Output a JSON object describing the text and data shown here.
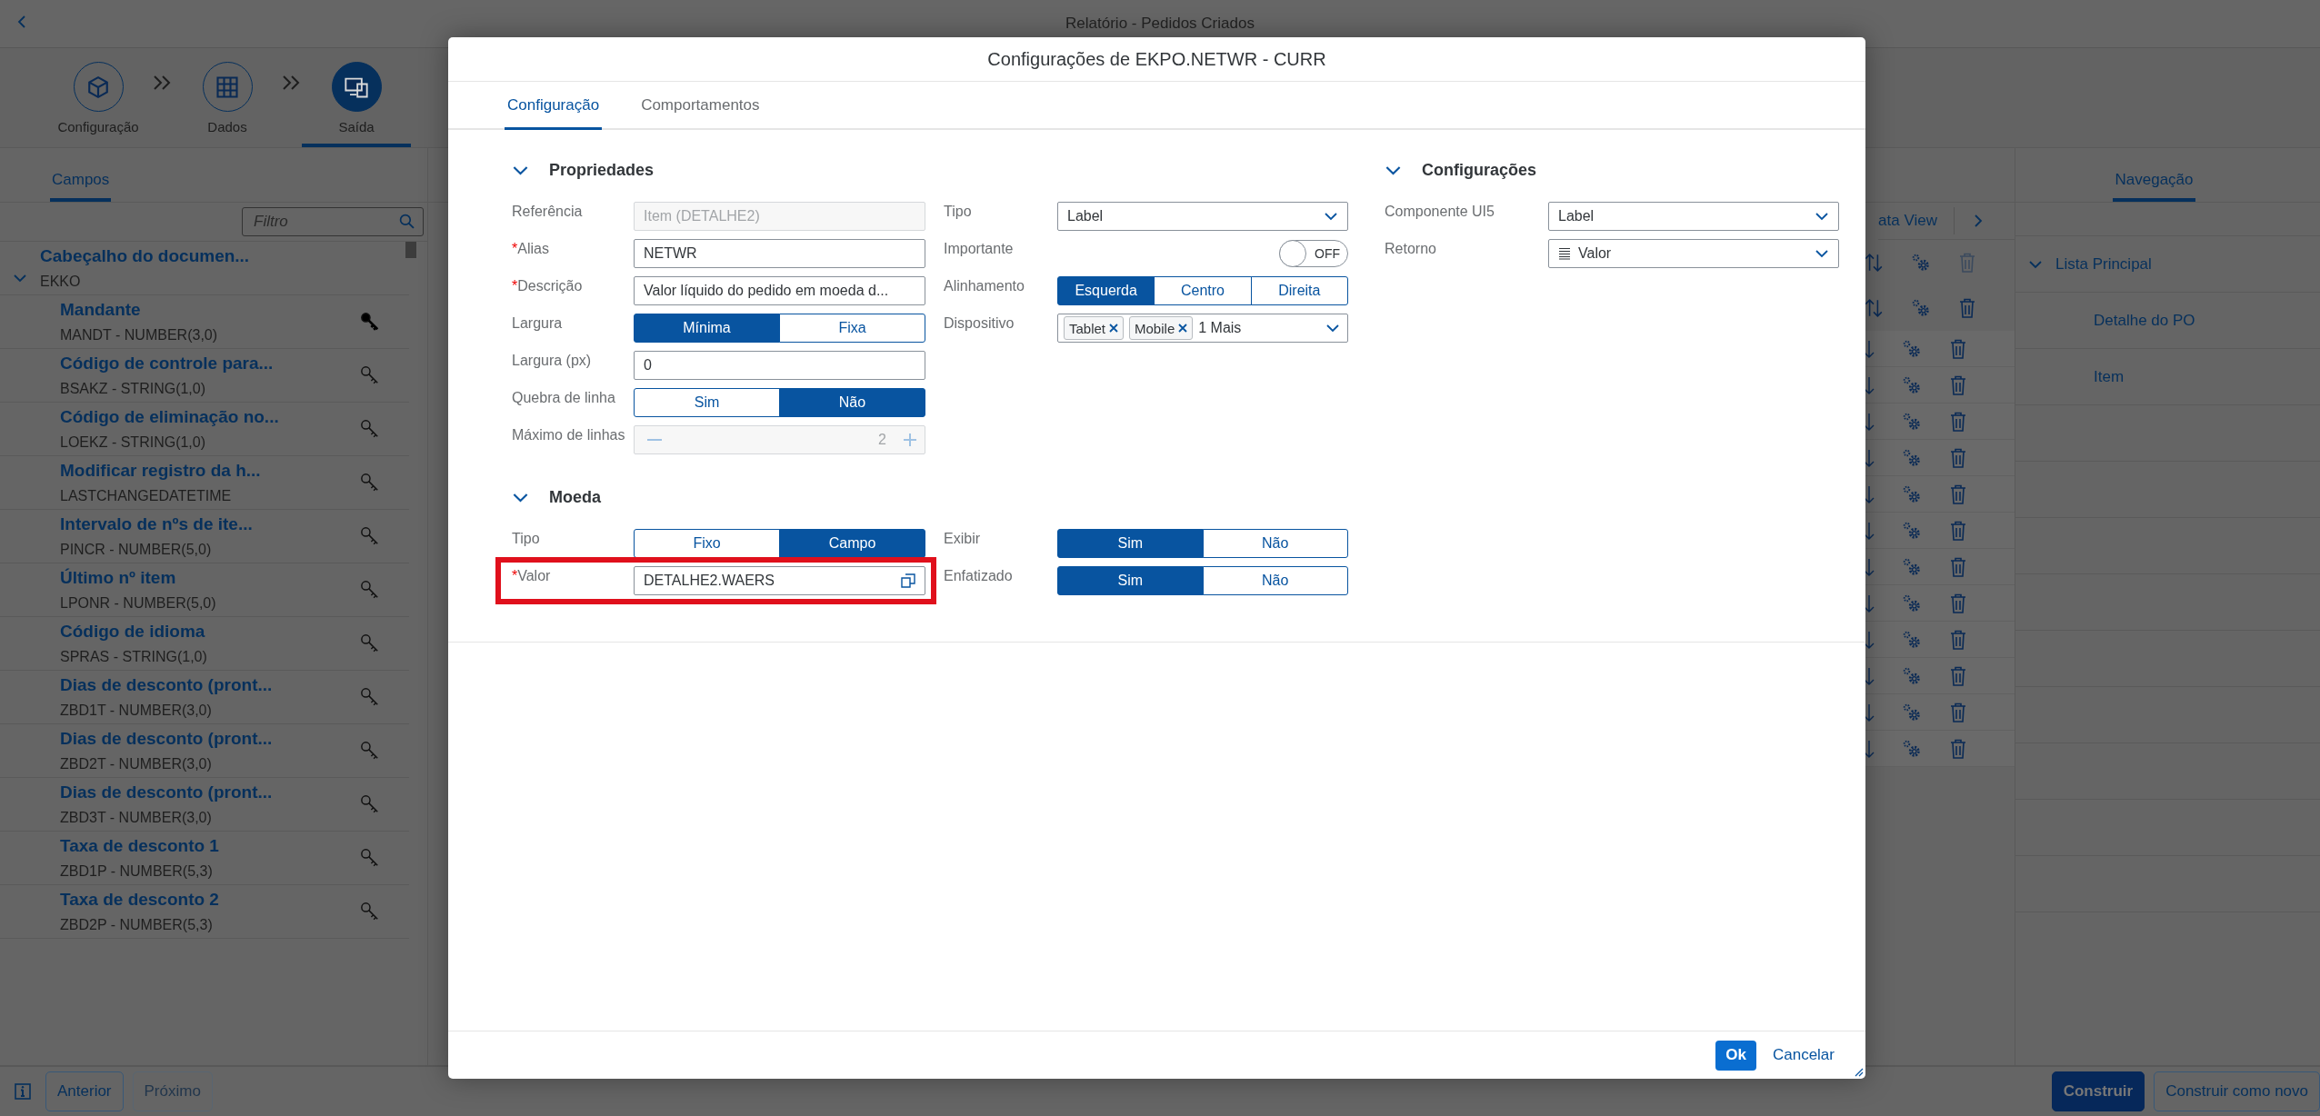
{
  "header": {
    "title": "Relatório - Pedidos Criados"
  },
  "wizard": {
    "steps": [
      {
        "label": "Configuração",
        "kind": "config",
        "selected": false
      },
      {
        "label": "Dados",
        "kind": "data",
        "selected": false
      },
      {
        "label": "Saída",
        "kind": "output",
        "selected": true
      }
    ]
  },
  "left_panel": {
    "tab": {
      "label": "Campos",
      "selected": true
    },
    "filter": {
      "placeholder": "Filtro"
    },
    "tree": [
      {
        "label": "Cabeçalho do documen...",
        "sublabel": "EKKO",
        "expanded": true,
        "children": [
          {
            "label": "Mandante",
            "sublabel": "MANDT - NUMBER(3,0)",
            "key_active": true
          },
          {
            "label": "Código de controle para...",
            "sublabel": "BSAKZ - STRING(1,0)",
            "key_active": false
          },
          {
            "label": "Código de eliminação no...",
            "sublabel": "LOEKZ - STRING(1,0)",
            "key_active": false
          },
          {
            "label": "Modificar registro da h...",
            "sublabel": "LASTCHANGEDATETIME",
            "key_active": false
          },
          {
            "label": "Intervalo de nºs de ite...",
            "sublabel": "PINCR - NUMBER(5,0)",
            "key_active": false
          },
          {
            "label": "Último nº item",
            "sublabel": "LPONR - NUMBER(5,0)",
            "key_active": false
          },
          {
            "label": "Código de idioma",
            "sublabel": "SPRAS - STRING(1,0)",
            "key_active": false
          },
          {
            "label": "Dias de desconto (pront...",
            "sublabel": "ZBD1T - NUMBER(3,0)",
            "key_active": false
          },
          {
            "label": "Dias de desconto (pront...",
            "sublabel": "ZBD2T - NUMBER(3,0)",
            "key_active": false
          },
          {
            "label": "Dias de desconto (pront...",
            "sublabel": "ZBD3T - NUMBER(3,0)",
            "key_active": false
          },
          {
            "label": "Taxa de desconto 1",
            "sublabel": "ZBD1P - NUMBER(5,3)",
            "key_active": false
          },
          {
            "label": "Taxa de desconto 2",
            "sublabel": "ZBD2P - NUMBER(5,3)",
            "key_active": false
          }
        ]
      }
    ]
  },
  "middle_panel": {
    "toolbar_text": "ata View",
    "rows": [
      {
        "kind": "group",
        "delete_enabled": false
      },
      {
        "kind": "group",
        "delete_enabled": true
      },
      {
        "kind": "field",
        "delete_enabled": true
      },
      {
        "kind": "field",
        "delete_enabled": true
      },
      {
        "kind": "field",
        "delete_enabled": true
      },
      {
        "kind": "field",
        "delete_enabled": true
      },
      {
        "kind": "field",
        "delete_enabled": true
      },
      {
        "kind": "field",
        "delete_enabled": true
      },
      {
        "kind": "field",
        "delete_enabled": true
      },
      {
        "kind": "field",
        "delete_enabled": true
      },
      {
        "kind": "field",
        "delete_enabled": true
      },
      {
        "kind": "field",
        "delete_enabled": true
      },
      {
        "kind": "field",
        "delete_enabled": true
      },
      {
        "kind": "field",
        "delete_enabled": true
      }
    ]
  },
  "right_panel": {
    "tab": {
      "label": "Navegação",
      "selected": true
    },
    "tree": [
      {
        "label": "Lista Principal",
        "expanded": true,
        "children": [
          {
            "label": "Detalhe do PO"
          },
          {
            "label": "Item"
          }
        ]
      }
    ]
  },
  "footer": {
    "left_buttons": [
      {
        "label": "Anterior",
        "disabled": false
      },
      {
        "label": "Próximo",
        "disabled": true
      }
    ],
    "right_buttons": [
      {
        "label": "Construir",
        "emphasized": true
      },
      {
        "label": "Construir como novo",
        "emphasized": false
      }
    ]
  },
  "dialog": {
    "title": "Configurações de EKPO.NETWR - CURR",
    "tabs": [
      {
        "label": "Configuração",
        "selected": true
      },
      {
        "label": "Comportamentos",
        "selected": false
      }
    ],
    "left_sections": [
      {
        "title": "Propriedades",
        "expanded": true,
        "columns": [
          [
            {
              "label": "Referência",
              "kind": "input",
              "value": "Item (DETALHE2)",
              "disabled": true
            },
            {
              "label": "Alias",
              "required_mark": "*",
              "kind": "input",
              "value": "NETWR",
              "disabled": false
            },
            {
              "label": "Descrição",
              "required_mark": "*",
              "kind": "input",
              "value": "Valor líquido do pedido em moeda d...",
              "disabled": false
            },
            {
              "label": "Largura",
              "kind": "segmented",
              "options": [
                {
                  "label": "Mínima",
                  "selected": true
                },
                {
                  "label": "Fixa",
                  "selected": false
                }
              ]
            },
            {
              "label": "Largura (px)",
              "kind": "input",
              "value": "0",
              "disabled": false
            },
            {
              "label": "Quebra de linha",
              "kind": "segmented",
              "options": [
                {
                  "label": "Sim",
                  "selected": false
                },
                {
                  "label": "Não",
                  "selected": true
                }
              ]
            },
            {
              "label": "Máximo de linhas",
              "kind": "stepper",
              "value": "2",
              "disabled": true
            }
          ],
          [
            {
              "label": "Tipo",
              "kind": "select",
              "value": "Label"
            },
            {
              "label": "Importante",
              "kind": "switch",
              "on": false,
              "text": "OFF"
            },
            {
              "label": "Alinhamento",
              "kind": "segmented",
              "options": [
                {
                  "label": "Esquerda",
                  "selected": true
                },
                {
                  "label": "Centro",
                  "selected": false
                },
                {
                  "label": "Direita",
                  "selected": false
                }
              ]
            },
            {
              "label": "Dispositivo",
              "kind": "tokens",
              "tokens": [
                {
                  "label": "Tablet"
                },
                {
                  "label": "Mobile"
                }
              ],
              "more": "1 Mais"
            }
          ]
        ]
      },
      {
        "title": "Moeda",
        "expanded": true,
        "columns": [
          [
            {
              "label": "Tipo",
              "kind": "segmented",
              "options": [
                {
                  "label": "Fixo",
                  "selected": false
                },
                {
                  "label": "Campo",
                  "selected": true
                }
              ]
            },
            {
              "label": "Valor",
              "required_mark": "*",
              "kind": "value_help",
              "value": "DETALHE2.WAERS",
              "highlighted": true
            }
          ],
          [
            {
              "label": "Exibir",
              "kind": "segmented",
              "options": [
                {
                  "label": "Sim",
                  "selected": true
                },
                {
                  "label": "Não",
                  "selected": false
                }
              ]
            },
            {
              "label": "Enfatizado",
              "kind": "segmented",
              "options": [
                {
                  "label": "Sim",
                  "selected": true
                },
                {
                  "label": "Não",
                  "selected": false
                }
              ]
            }
          ]
        ]
      }
    ],
    "right_sections": [
      {
        "title": "Configurações",
        "expanded": true,
        "columns": [
          [
            {
              "label": "Componente UI5",
              "kind": "select",
              "value": "Label"
            },
            {
              "label": "Retorno",
              "kind": "select_list",
              "value": "Valor"
            }
          ]
        ]
      }
    ],
    "ok": "Ok",
    "cancel": "Cancelar"
  }
}
